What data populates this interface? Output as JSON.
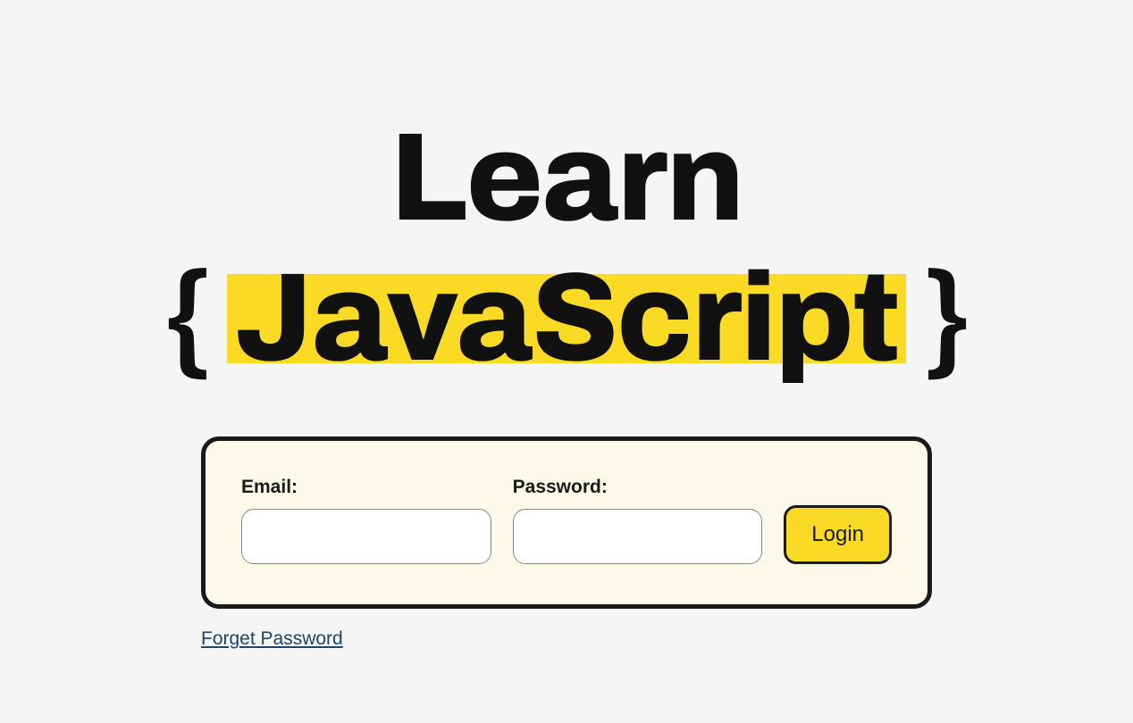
{
  "logo": {
    "line1": "Learn",
    "brace_open": "{",
    "highlighted": "JavaScript",
    "brace_close": "}"
  },
  "form": {
    "email_label": "Email:",
    "email_value": "",
    "password_label": "Password:",
    "password_value": "",
    "login_button": "Login"
  },
  "links": {
    "forgot_password": "Forget Password"
  },
  "colors": {
    "highlight": "#FADA25",
    "card_bg": "#FDF9E8",
    "border": "#1a1a1a",
    "link": "#1d4569"
  }
}
